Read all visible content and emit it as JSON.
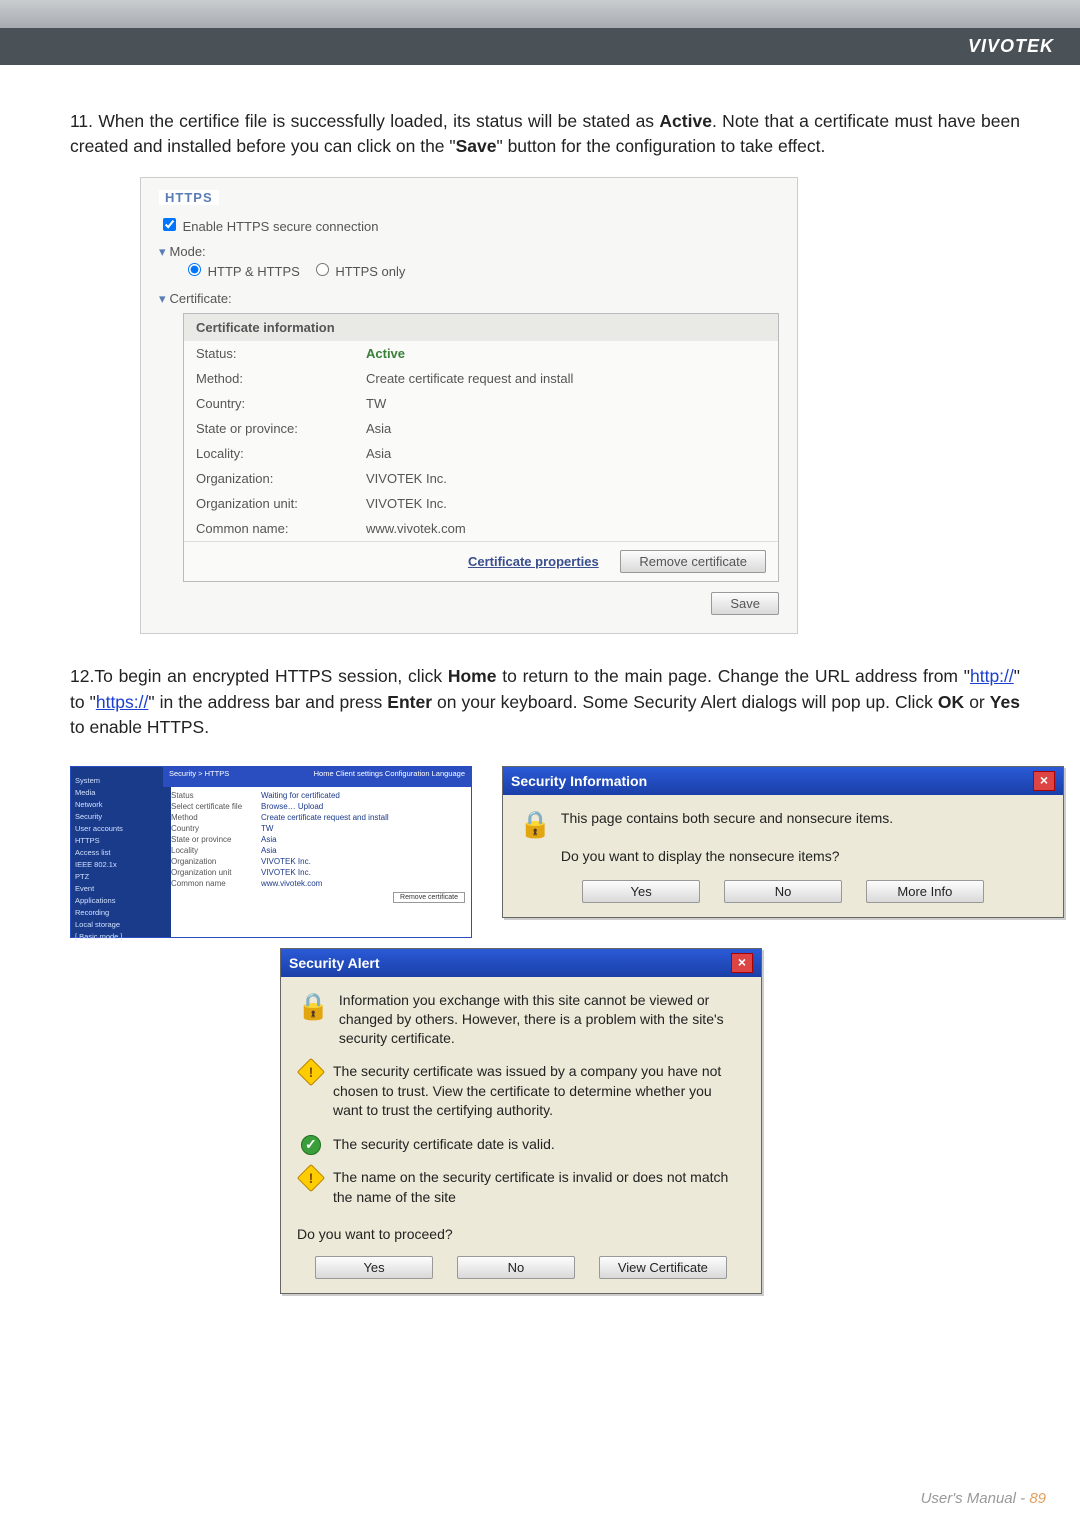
{
  "brand": "VIVOTEK",
  "step11": {
    "prefix": "11. When the certifice file is successfully loaded, its status will be stated as ",
    "active": "Active",
    "mid": ". Note that a certificate must have been created and installed before you can click on the \"",
    "save": "Save",
    "suffix": "\" button for the configuration to take effect."
  },
  "https_panel": {
    "legend": "HTTPS",
    "enable": "Enable HTTPS secure connection",
    "mode_label": "Mode:",
    "mode_a": "HTTP & HTTPS",
    "mode_b": "HTTPS only",
    "cert_label": "Certificate:",
    "cert_info": "Certificate information",
    "rows": [
      {
        "k": "Status:",
        "v": "Active",
        "active": true
      },
      {
        "k": "Method:",
        "v": "Create certificate request and install"
      },
      {
        "k": "Country:",
        "v": "TW"
      },
      {
        "k": "State or province:",
        "v": "Asia"
      },
      {
        "k": "Locality:",
        "v": "Asia"
      },
      {
        "k": "Organization:",
        "v": "VIVOTEK Inc."
      },
      {
        "k": "Organization unit:",
        "v": "VIVOTEK Inc."
      },
      {
        "k": "Common name:",
        "v": "www.vivotek.com"
      }
    ],
    "cert_props": "Certificate properties",
    "remove": "Remove certificate",
    "save_btn": "Save"
  },
  "step12": {
    "prefix": "12.To begin an encrypted HTTPS session, click ",
    "home": "Home",
    "mid1": " to return to the main page. Change the URL address from \"",
    "http": "http://",
    "mid2": "\" to \"",
    "https": "https://",
    "mid3": "\" in the address bar and press ",
    "enter": "Enter",
    "mid4": " on your keyboard. Some Security Alert dialogs will pop up. Click ",
    "ok": "OK",
    "or": " or ",
    "yes": "Yes",
    "suffix": " to enable HTTPS."
  },
  "thumb": {
    "title": "Security > HTTPS",
    "bar": "Home   Client settings   Configuration   Language",
    "nav": [
      "System",
      "Media",
      "Network",
      "Security",
      "User accounts",
      "HTTPS",
      "Access list",
      "IEEE 802.1x",
      "PTZ",
      "Event",
      "Applications",
      "Recording",
      "Local storage",
      "[ Basic mode ]"
    ],
    "rows": [
      {
        "k": "Status",
        "v": "Waiting for certificated"
      },
      {
        "k": "Select certificate file",
        "v": "Browse… Upload"
      },
      {
        "k": "Method",
        "v": "Create certificate request and install"
      },
      {
        "k": "Country",
        "v": "TW"
      },
      {
        "k": "State or province",
        "v": "Asia"
      },
      {
        "k": "Locality",
        "v": "Asia"
      },
      {
        "k": "Organization",
        "v": "VIVOTEK Inc."
      },
      {
        "k": "Organization unit",
        "v": "VIVOTEK Inc."
      },
      {
        "k": "Common name",
        "v": "www.vivotek.com"
      }
    ],
    "remove": "Remove certificate"
  },
  "sec_info": {
    "title": "Security Information",
    "line1": "This page contains both secure and nonsecure items.",
    "line2": "Do you want to display the nonsecure items?",
    "yes": "Yes",
    "no": "No",
    "more": "More Info"
  },
  "alert": {
    "title": "Security Alert",
    "intro": "Information you exchange with this site cannot be viewed or changed by others. However, there is a problem with the site's security certificate.",
    "i1": "The security certificate was issued by a company you have not chosen to trust. View the certificate to determine whether you want to trust the certifying authority.",
    "i2": "The security certificate date is valid.",
    "i3": "The name on the security certificate is invalid or does not match the name of the site",
    "proceed": "Do you want to proceed?",
    "yes": "Yes",
    "no": "No",
    "view": "View Certificate"
  },
  "footer": {
    "label": "User's Manual - ",
    "page": "89"
  }
}
